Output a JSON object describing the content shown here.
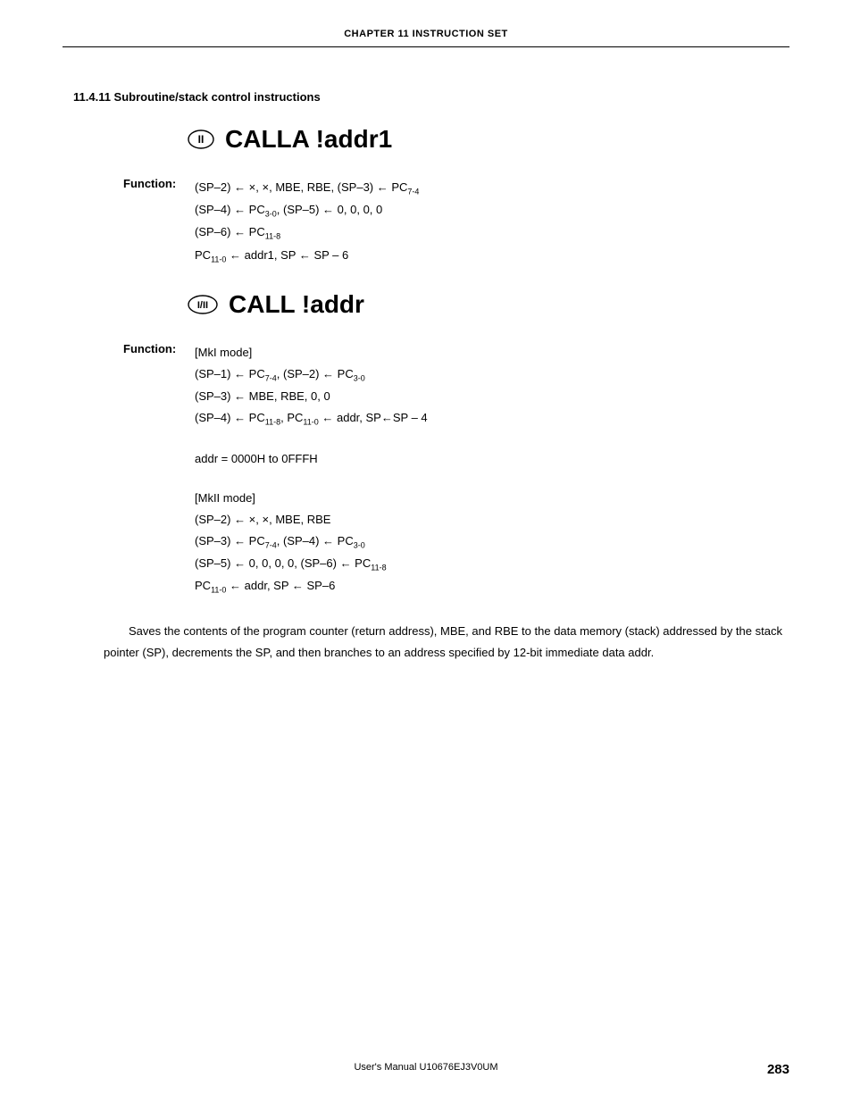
{
  "chapter_header": "CHAPTER 11   INSTRUCTION SET",
  "section": "11.4.11  Subroutine/stack control instructions",
  "instr1": {
    "mode_label": "II",
    "title": "CALLA !addr1",
    "func_label": "Function:",
    "lines": [
      "(SP–2) ← ×, ×, MBE, RBE, (SP–3) ← PC|7-4|",
      "(SP–4) ← PC|3-0|, (SP–5) ← 0, 0, 0, 0",
      "(SP–6) ← PC|11-8|",
      "PC|11-0| ← addr1, SP ← SP – 6"
    ]
  },
  "instr2": {
    "mode_label": "I/II",
    "title": "CALL !addr",
    "func_label": "Function:",
    "block1_heading": "[MkI mode]",
    "block1_lines": [
      "(SP–1) ← PC|7-4|, (SP–2) ← PC|3-0|",
      "(SP–3) ← MBE, RBE, 0, 0",
      "(SP–4) ← PC|11-8|, PC|11-0| ← addr, SP←SP – 4"
    ],
    "addr_range": "addr = 0000H to 0FFFH",
    "block2_heading": "[MkII mode]",
    "block2_lines": [
      "(SP–2) ← ×, ×, MBE, RBE",
      "(SP–3) ← PC|7-4|, (SP–4) ← PC|3-0|",
      "(SP–5) ← 0, 0, 0, 0, (SP–6) ← PC|11-8|",
      "PC|11-0| ← addr, SP ← SP–6"
    ]
  },
  "description": "Saves the contents of the program counter (return address), MBE, and RBE to the data memory (stack) addressed by the stack pointer (SP), decrements the SP, and then branches to an address specified by 12-bit immediate data addr.",
  "footer_text": "User's Manual  U10676EJ3V0UM",
  "page_number": "283"
}
